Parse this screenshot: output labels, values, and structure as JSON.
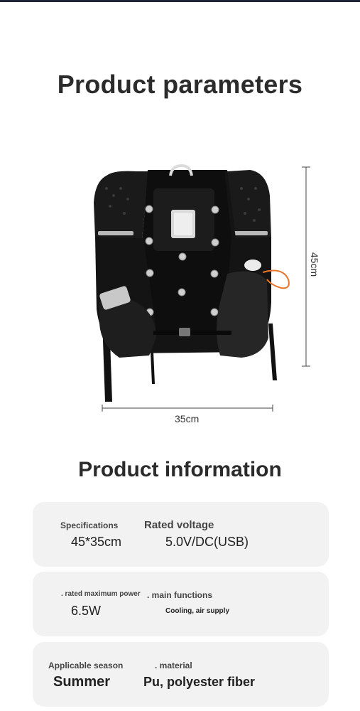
{
  "header": {
    "params_title": "Product parameters",
    "info_title": "Product information"
  },
  "dimensions": {
    "width": "35cm",
    "height": "45cm"
  },
  "cards": [
    {
      "left_label": "Specifications",
      "left_value": "45*35cm",
      "right_label": "Rated voltage",
      "right_value": "5.0V/DC(USB)"
    },
    {
      "left_label": ". rated maximum power",
      "left_value": "6.5W",
      "right_label": ". main functions",
      "right_value": "Cooling, air supply"
    },
    {
      "left_label": "Applicable season",
      "left_value": "Summer",
      "right_label": ". material",
      "right_value": "Pu, polyester fiber"
    }
  ],
  "colors": {
    "top_bar": "#1e2436",
    "card_bg": "#f2f2f2",
    "title": "#2b2b2b",
    "cord_accent": "#e8742a"
  }
}
